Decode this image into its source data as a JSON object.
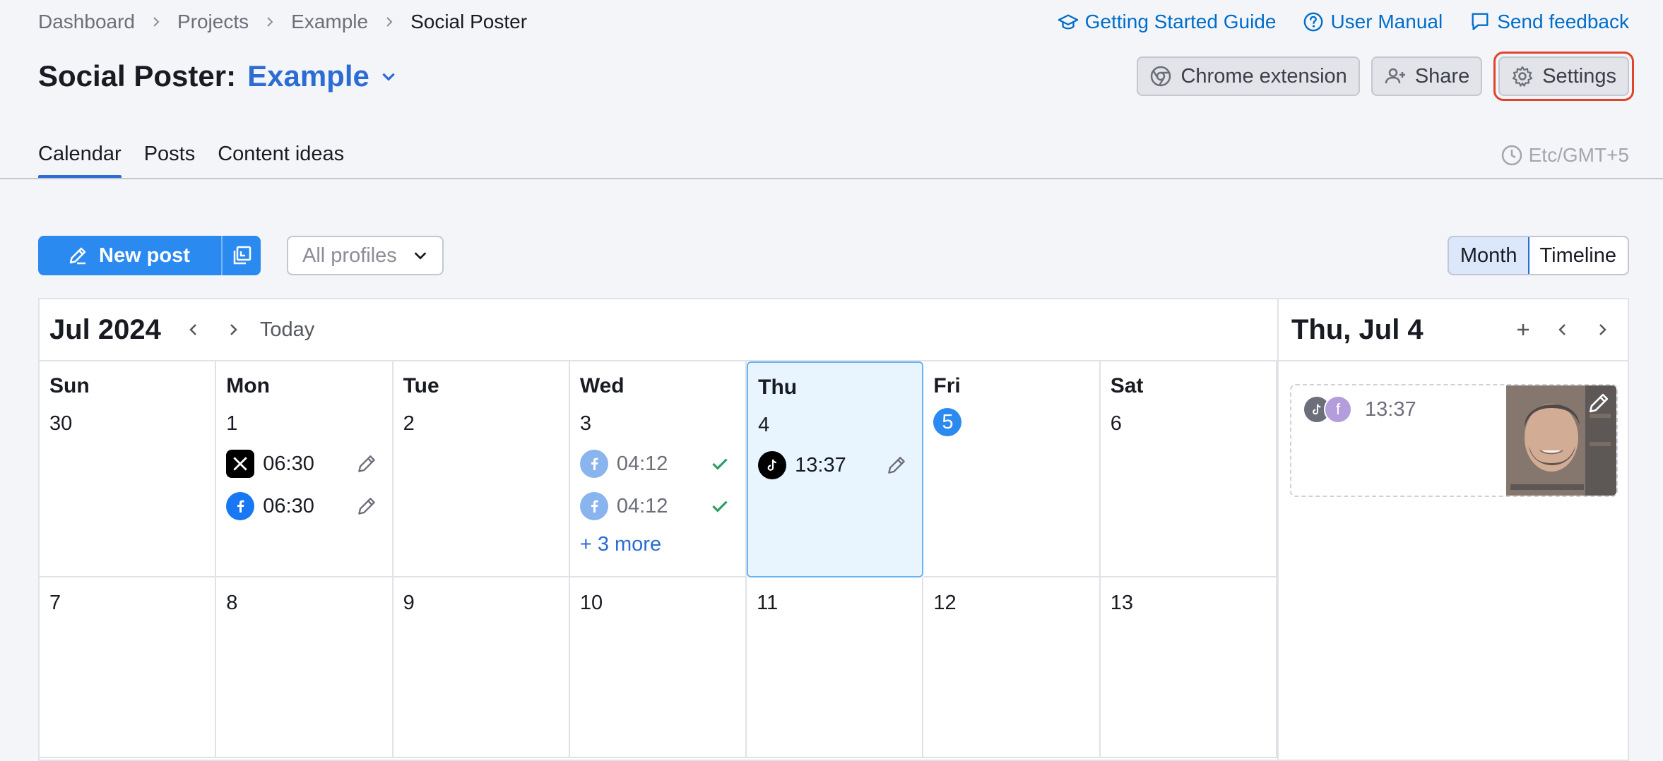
{
  "breadcrumb": [
    "Dashboard",
    "Projects",
    "Example",
    "Social Poster"
  ],
  "toplinks": {
    "guide": "Getting Started Guide",
    "manual": "User Manual",
    "feedback": "Send feedback"
  },
  "title": {
    "prefix": "Social Poster:",
    "project": "Example"
  },
  "actions": {
    "chrome": "Chrome extension",
    "share": "Share",
    "settings": "Settings"
  },
  "tabs": [
    "Calendar",
    "Posts",
    "Content ideas"
  ],
  "timezone": "Etc/GMT+5",
  "toolbar": {
    "new_post": "New post",
    "profiles": "All profiles"
  },
  "view": {
    "month": "Month",
    "timeline": "Timeline"
  },
  "calendar": {
    "month": "Jul 2024",
    "today": "Today",
    "days": [
      "Sun",
      "Mon",
      "Tue",
      "Wed",
      "Thu",
      "Fri",
      "Sat"
    ],
    "week1": [
      "30",
      "1",
      "2",
      "3",
      "4",
      "5",
      "6"
    ],
    "week2": [
      "7",
      "8",
      "9",
      "10",
      "11",
      "12",
      "13"
    ],
    "posts": {
      "mon1": "06:30",
      "mon2": "06:30",
      "wed1": "04:12",
      "wed2": "04:12",
      "wed_more": "+ 3 more",
      "thu1": "13:37"
    }
  },
  "side": {
    "date": "Thu, Jul 4",
    "post_time": "13:37",
    "avatar_f": "f"
  },
  "colors": {
    "accent": "#2b6dd3",
    "primary_button": "#2b8af0",
    "settings_highlight": "#e0442b",
    "facebook": "#1877f2",
    "check": "#2e9e6a"
  }
}
